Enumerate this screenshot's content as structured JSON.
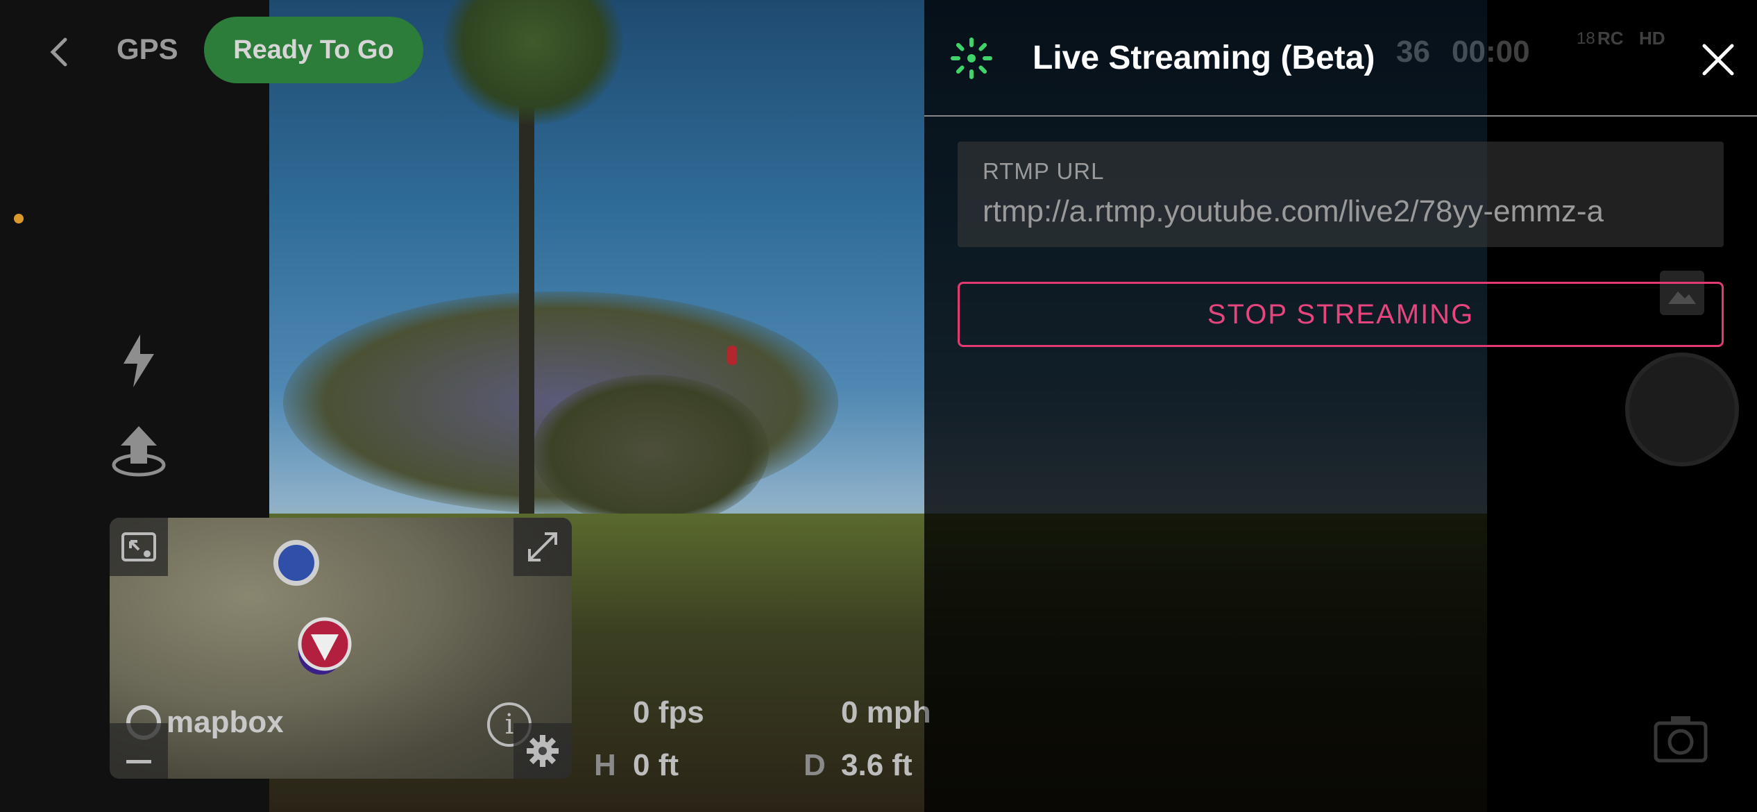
{
  "top_bar": {
    "gps_label": "GPS",
    "status": "Ready To Go"
  },
  "mini_map": {
    "logo_text": "mapbox"
  },
  "telemetry": {
    "fps_value": "0 fps",
    "speed_value": "0 mph",
    "height_prefix": "H",
    "height_value": "0 ft",
    "distance_prefix": "D",
    "distance_value": "3.6 ft"
  },
  "streaming_panel": {
    "title": "Live Streaming (Beta)",
    "rtmp_label": "RTMP URL",
    "rtmp_value": "rtmp://a.rtmp.youtube.com/live2/78yy-emmz-a",
    "stop_label": "STOP STREAMING"
  },
  "background_status": {
    "battery": "36",
    "timer": "00:00",
    "satellites": "18",
    "rc_label": "RC",
    "hd_label": "HD"
  },
  "colors": {
    "accent_green": "#2d7d3a",
    "stream_icon_green": "#3fd36a",
    "stop_pink": "#e8457e"
  },
  "icons": [
    "back-chevron-icon",
    "flash-icon",
    "takeoff-icon",
    "picture-in-picture-icon",
    "expand-icon",
    "info-icon",
    "gear-icon",
    "stream-icon",
    "close-icon",
    "gallery-icon",
    "camera-icon"
  ]
}
